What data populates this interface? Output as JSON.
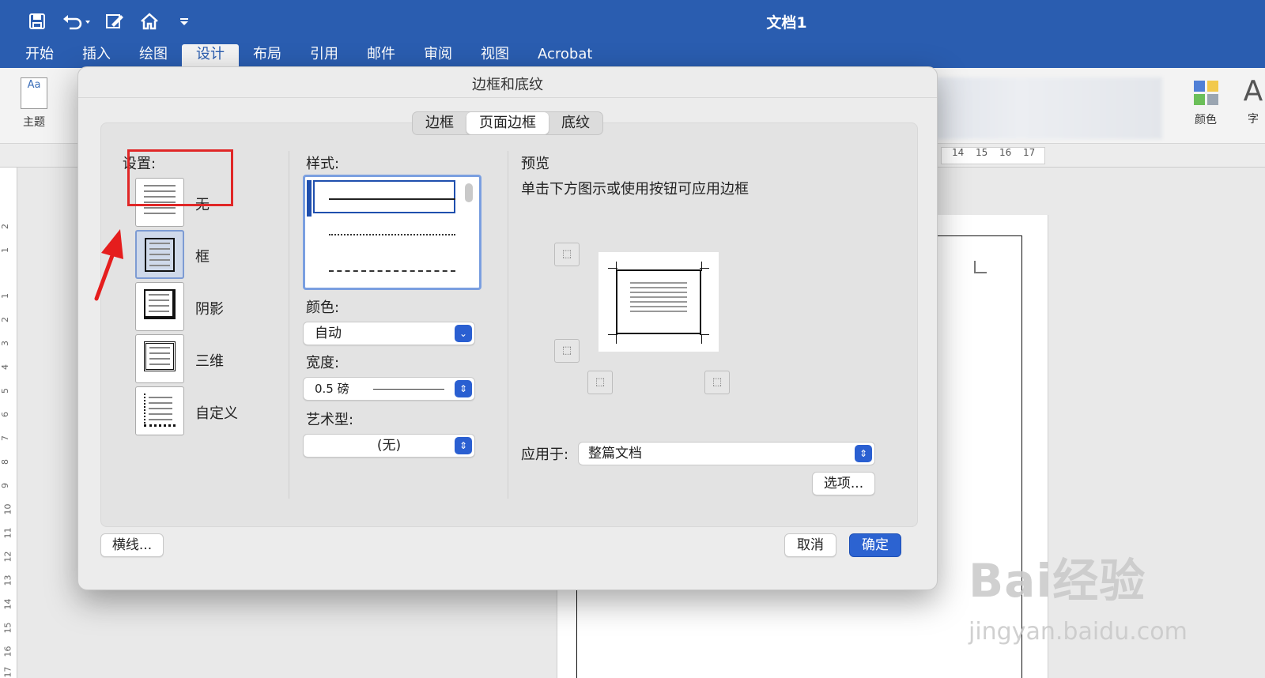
{
  "window": {
    "title": "文档1",
    "quick_access": [
      "save-icon",
      "undo-icon",
      "edit-icon",
      "home-icon",
      "customize-icon"
    ]
  },
  "ribbon_tabs": [
    "开始",
    "插入",
    "绘图",
    "设计",
    "布局",
    "引用",
    "邮件",
    "审阅",
    "视图",
    "Acrobat"
  ],
  "ribbon": {
    "theme_label": "主题",
    "theme_icon_text": "Aa",
    "colors_label": "颜色",
    "fonts_label": "字",
    "fonts_icon_text": "A"
  },
  "ruler": {
    "h_numbers": [
      "14",
      "15",
      "16",
      "17"
    ],
    "v_numbers": [
      "2",
      "1",
      "1",
      "2",
      "3",
      "4",
      "5",
      "6",
      "7",
      "8",
      "9",
      "10",
      "11",
      "12",
      "13",
      "14",
      "15",
      "16",
      "17"
    ]
  },
  "dialog": {
    "title": "边框和底纹",
    "tabs": [
      "边框",
      "页面边框",
      "底纹"
    ],
    "active_tab": "页面边框",
    "settings_label": "设置:",
    "settings": [
      "无",
      "框",
      "阴影",
      "三维",
      "自定义"
    ],
    "selected_setting": "框",
    "style_label": "样式:",
    "color_label": "颜色:",
    "color_value": "自动",
    "width_label": "宽度:",
    "width_value": "0.5 磅",
    "art_label": "艺术型:",
    "art_value": "(无)",
    "preview_label": "预览",
    "preview_hint": "单击下方图示或使用按钮可应用边框",
    "apply_label": "应用于:",
    "apply_value": "整篇文档",
    "options_button": "选项...",
    "hline_button": "横线...",
    "cancel_button": "取消",
    "ok_button": "确定"
  },
  "watermark": {
    "brand": "Bai经验",
    "url": "jingyan.baidu.com"
  },
  "colors": {
    "titlebar": "#2a5db0",
    "primary_button": "#2c63d1",
    "highlight_box": "#e02727",
    "annotation_arrow": "#e51d1d"
  }
}
